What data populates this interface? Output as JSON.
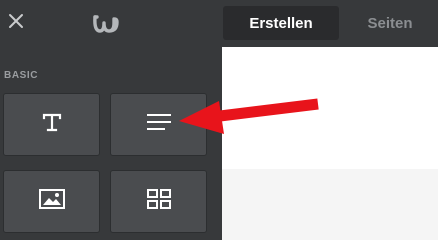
{
  "toolbar": {
    "close_icon": "close-icon",
    "logo_icon": "weebly-logo-icon",
    "tabs": [
      {
        "label": "Erstellen",
        "active": true
      },
      {
        "label": "Seiten",
        "active": false
      }
    ]
  },
  "sidebar": {
    "section_label": "BASIC",
    "elements": [
      {
        "icon": "text-icon"
      },
      {
        "icon": "paragraph-lines-icon"
      },
      {
        "icon": "image-icon"
      },
      {
        "icon": "gallery-grid-icon"
      }
    ]
  },
  "annotation": {
    "color": "#e8141b",
    "points_to": "paragraph-lines-icon"
  },
  "colors": {
    "sidebar_bg": "#37393b",
    "tile_bg": "#4a4c4f",
    "active_tab_bg": "#2a2b2d",
    "canvas_bg": "#ffffff"
  }
}
